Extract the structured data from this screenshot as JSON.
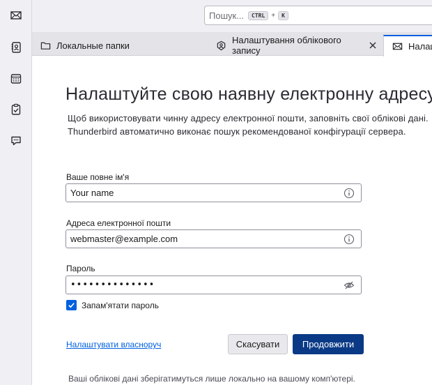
{
  "search": {
    "placeholder": "Пошук...",
    "shortcut_key1": "CTRL",
    "shortcut_plus": "+",
    "shortcut_key2": "K"
  },
  "spaces": [
    {
      "icon": "mail-icon"
    },
    {
      "icon": "address-book-icon"
    },
    {
      "icon": "calendar-icon"
    },
    {
      "icon": "tasks-icon"
    },
    {
      "icon": "chat-icon"
    }
  ],
  "tabs": [
    {
      "label": "Локальные папки",
      "icon": "folder-icon"
    },
    {
      "label": "Налаштування облікового запису",
      "icon": "account-settings-icon"
    },
    {
      "label": "Налаш",
      "icon": "mail-icon",
      "active": true
    }
  ],
  "page": {
    "title": "Налаштуйте свою наявну електронну адресу",
    "desc_line1": "Щоб використовувати чинну адресу електронної пошти, заповніть свої облікові дані.",
    "desc_line2": "Thunderbird автоматично виконає пошук рекомендованої конфігурації сервера."
  },
  "form": {
    "name_label": "Ваше повне ім'я",
    "name_value": "Your name",
    "email_label": "Адреса електронної пошти",
    "email_value": "webmaster@example.com",
    "password_label": "Пароль",
    "password_value": "••••••••••••••",
    "remember_label": "Запам'ятати пароль",
    "remember_checked": true
  },
  "actions": {
    "manual_link": "Налаштувати власноруч",
    "cancel": "Скасувати",
    "continue": "Продовжити"
  },
  "footer": "Ваші облікові дані зберігатимуться лише локально на вашому комп'ютері.",
  "colors": {
    "accent": "#0060df",
    "primary_button": "#0a3a86"
  }
}
